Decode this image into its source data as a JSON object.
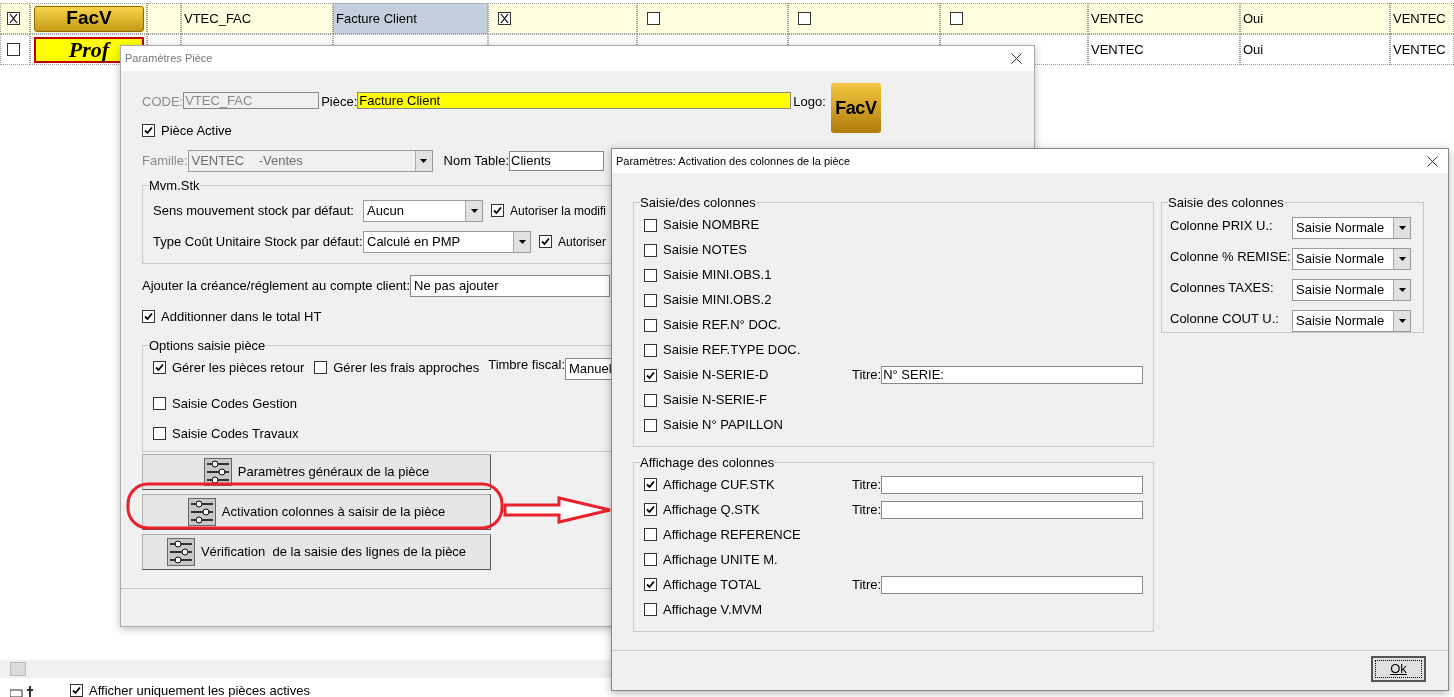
{
  "grid": {
    "rows": [
      {
        "cells": [
          {
            "kind": "check",
            "checked": true
          },
          {
            "kind": "logo",
            "text": "FacV"
          },
          {
            "kind": "blank"
          },
          {
            "kind": "text",
            "text": "VTEC_FAC",
            "selected": false
          },
          {
            "kind": "text",
            "text": "Facture Client",
            "selected": true
          },
          {
            "kind": "checkfield",
            "checked": true
          },
          {
            "kind": "checkfield",
            "checked": false
          },
          {
            "kind": "checkfield",
            "checked": false
          },
          {
            "kind": "checkfield",
            "checked": false
          },
          {
            "kind": "text",
            "text": "VENTEC",
            "selected": false
          },
          {
            "kind": "text",
            "text": "Oui",
            "selected": false
          },
          {
            "kind": "text",
            "text": "VENTEC",
            "selected": false
          }
        ]
      },
      {
        "cells": [
          {
            "kind": "check",
            "checked": false
          },
          {
            "kind": "logo",
            "text": "Prof"
          },
          {
            "kind": "blank"
          },
          {
            "kind": "blank"
          },
          {
            "kind": "blank"
          },
          {
            "kind": "blank"
          },
          {
            "kind": "blank"
          },
          {
            "kind": "blank"
          },
          {
            "kind": "blank"
          },
          {
            "kind": "text",
            "text": "VENTEC",
            "selected": false
          },
          {
            "kind": "text",
            "text": "Oui",
            "selected": false
          },
          {
            "kind": "text",
            "text": "VENTEC",
            "selected": false
          }
        ]
      }
    ]
  },
  "footer": {
    "active_only": {
      "label": "Afficher uniquement les pièces actives",
      "checked": true
    }
  },
  "piece_dialog": {
    "title": "Paramètres Pièce",
    "code": {
      "label": "CODE:",
      "value": "VTEC_FAC",
      "disabled": true
    },
    "piece": {
      "label": "Pièce:",
      "value": "Facture Client"
    },
    "logo": {
      "label": "Logo:",
      "text": "FacV"
    },
    "active": {
      "label": "Pièce Active",
      "checked": true
    },
    "famille": {
      "label": "Famille:",
      "value": "VENTEC    -Ventes",
      "disabled": true
    },
    "nom_table": {
      "label": "Nom Table:",
      "value": "Clients"
    },
    "mvm_stk": {
      "title": "Mvm.Stk",
      "rows": [
        {
          "label": "Sens mouvement stock par défaut:",
          "value": "Aucun",
          "option": {
            "label": "Autoriser la modifi",
            "checked": true
          }
        },
        {
          "label": "Type Coût Unitaire Stock par défaut:",
          "value": "Calculé en PMP",
          "option": {
            "label": "Autoriser",
            "checked": true
          }
        }
      ]
    },
    "creance": {
      "label": "Ajouter la créance/réglement au compte client:",
      "value": "Ne pas ajouter"
    },
    "total_ht": {
      "label": "Additionner dans le total HT",
      "checked": true
    },
    "options": {
      "title": "Options saisie pièce",
      "retour": {
        "label": "Gérer les pièces retour",
        "checked": true
      },
      "frais": {
        "label": "Gérer les frais approches",
        "checked": false
      },
      "timbre": {
        "label": "Timbre fiscal:",
        "value": "Manuel"
      },
      "codes": [
        {
          "label": "Saisie Codes Gestion",
          "checked": false
        },
        {
          "label": "Saisie Codes Travaux",
          "checked": false
        }
      ]
    },
    "buttons": [
      "Paramètres généraux de la pièce",
      "Activation colonnes à saisir de la pièce",
      "Vérification  de la saisie des lignes de la pièce"
    ]
  },
  "columns_dialog": {
    "title": "Paramètres: Activation des colonnes de la pièce",
    "saisie": {
      "title": "Saisie/des colonnes",
      "items": [
        {
          "label": "Saisie NOMBRE",
          "checked": false
        },
        {
          "label": "Saisie NOTES",
          "checked": false
        },
        {
          "label": "Saisie MINI.OBS.1",
          "checked": false
        },
        {
          "label": "Saisie MINI.OBS.2",
          "checked": false
        },
        {
          "label": "Saisie REF.N° DOC.",
          "checked": false
        },
        {
          "label": "Saisie REF.TYPE DOC.",
          "checked": false
        },
        {
          "label": "Saisie N-SERIE-D",
          "checked": true,
          "titre": {
            "label": "Titre:",
            "value": "N° SERIE:"
          }
        },
        {
          "label": "Saisie N-SERIE-F",
          "checked": false
        },
        {
          "label": "Saisie N° PAPILLON",
          "checked": false
        }
      ]
    },
    "affichage": {
      "title": "Affichage des colonnes",
      "items": [
        {
          "label": "Affichage CUF.STK",
          "checked": true,
          "titre": {
            "label": "Titre:"
          }
        },
        {
          "label": "Affichage Q.STK",
          "checked": true,
          "titre": {
            "label": "Titre:"
          }
        },
        {
          "label": "Affichage REFERENCE",
          "checked": false
        },
        {
          "label": "Affichage UNITE M.",
          "checked": false
        },
        {
          "label": "Affichage TOTAL",
          "checked": true,
          "titre": {
            "label": "Titre:"
          }
        },
        {
          "label": "Affichage V.MVM",
          "checked": false
        }
      ]
    },
    "modes": {
      "title": "Saisie des colonnes",
      "items": [
        {
          "label": "Colonne PRIX U.:",
          "value": "Saisie Normale"
        },
        {
          "label": "Colonne % REMISE:",
          "value": "Saisie Normale"
        },
        {
          "label": "Colonnes TAXES:",
          "value": "Saisie Normale"
        },
        {
          "label": "Colonne COUT U.:",
          "value": "Saisie Normale"
        }
      ]
    },
    "ok": "Ok"
  }
}
